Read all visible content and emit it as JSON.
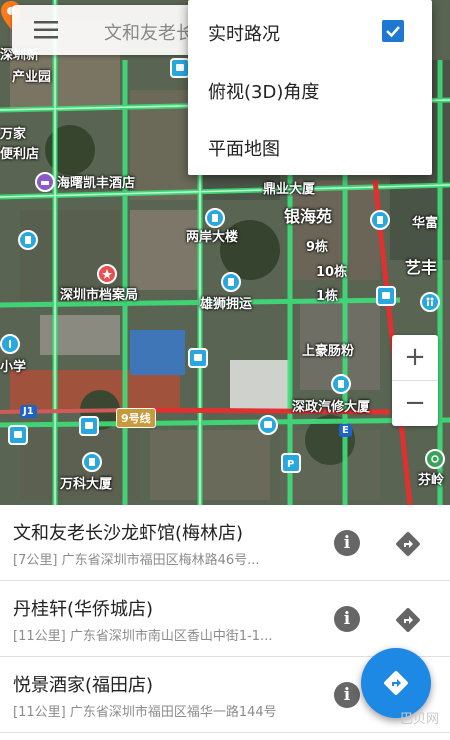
{
  "search": {
    "text": "文和友老长"
  },
  "menu": {
    "items": [
      {
        "label": "实时路况",
        "checked": true
      },
      {
        "label": "俯视(3D)角度",
        "checked": false
      },
      {
        "label": "平面地图",
        "checked": false
      }
    ]
  },
  "map": {
    "labels": {
      "l1": "深圳新",
      "l2": "产业园",
      "l3": "万家",
      "l4": "便利店",
      "l5": "海曙凯丰酒店",
      "l6": "鼎业大厦",
      "l7": "银海苑",
      "l8": "华富",
      "l9": "两岸大楼",
      "l10": "9栋",
      "l11": "10栋",
      "l12": "1栋",
      "l13": "艺丰",
      "l14": "深圳市档案局",
      "l15": "雄狮拥运",
      "l16": "上豪肠粉",
      "l17": "小学",
      "l18": "深政汽修大厦",
      "l19": "9号线",
      "l20": "万科大厦",
      "l21": "芬岭",
      "l22": "J1",
      "l23": "E"
    }
  },
  "zoom": {
    "in": "+",
    "out": "−"
  },
  "results": [
    {
      "title": "文和友老长沙龙虾馆(梅林店)",
      "distance": "[7公里]",
      "address": "广东省深圳市福田区梅林路46号..."
    },
    {
      "title": "丹桂轩(华侨城店)",
      "distance": "[11公里]",
      "address": "广东省深圳市南山区香山中街1-1..."
    },
    {
      "title": "悦景酒家(福田店)",
      "distance": "[11公里]",
      "address": "广东省深圳市福田区福华一路144号"
    }
  ],
  "watermark": "巴贝网",
  "colors": {
    "accent": "#1e88e5",
    "traffic_green": "#3ee07a",
    "traffic_red": "#e03030"
  }
}
